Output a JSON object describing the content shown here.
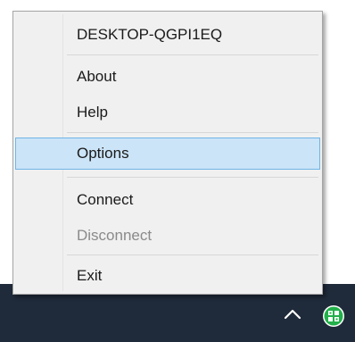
{
  "menu": {
    "items": [
      {
        "label": "DESKTOP-QGPI1EQ"
      },
      {
        "label": "About"
      },
      {
        "label": "Help"
      },
      {
        "label": "Options"
      },
      {
        "label": "Connect"
      },
      {
        "label": "Disconnect"
      },
      {
        "label": "Exit"
      }
    ],
    "highlighted": "Options",
    "disabled": [
      "Disconnect"
    ]
  },
  "taskbar": {
    "chevron_icon": "chevron-up-icon",
    "tray_icon": "green-network-app-icon"
  },
  "colors": {
    "menu_background": "#f0f0f0",
    "highlight_fill": "#cce4f7",
    "highlight_border": "#6fb5e6",
    "taskbar": "#1f2a3a",
    "tray_icon_green": "#22b04a"
  }
}
